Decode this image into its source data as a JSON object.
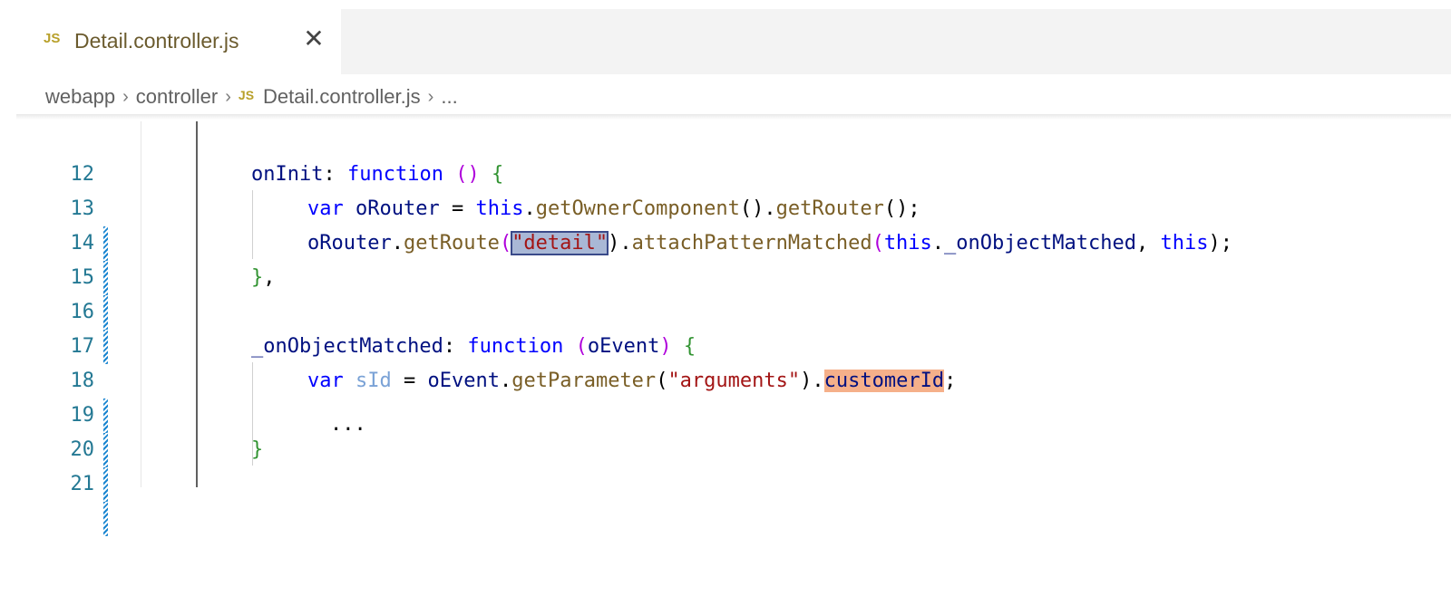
{
  "tab": {
    "icon": "JS",
    "filename": "Detail.controller.js",
    "close_glyph": "✕"
  },
  "breadcrumb": {
    "items": [
      "webapp",
      "controller"
    ],
    "file_icon": "JS",
    "file": "Detail.controller.js",
    "ellipsis": "...",
    "separator": "›"
  },
  "editor": {
    "line_numbers": [
      "12",
      "13",
      "14",
      "15",
      "16",
      "17",
      "18",
      "19",
      "20",
      "21"
    ],
    "lines": {
      "l13": {
        "a": "onInit",
        "b": ": ",
        "c": "function",
        "d": " ",
        "e": "()",
        "f": " ",
        "g": "{"
      },
      "l14": {
        "a": "var",
        "b": " ",
        "c": "oRouter",
        "d": " = ",
        "e": "this",
        "f": ".",
        "g": "getOwnerComponent",
        "h": "().",
        "i": "getRouter",
        "j": "();"
      },
      "l15": {
        "a": "oRouter",
        "b": ".",
        "c": "getRoute",
        "d": "(",
        "e": "\"detail\"",
        "f": ").",
        "g": "attachPatternMatched",
        "h": "(",
        "i": "this",
        "j": ".",
        "k": "_onObjectMatched",
        "l": ", ",
        "m": "this",
        "n": ");"
      },
      "l16": {
        "a": "}",
        "b": ","
      },
      "l18": {
        "a": "_onObjectMatched",
        "b": ": ",
        "c": "function",
        "d": " ",
        "e": "(",
        "f": "oEvent",
        "g": ")",
        "h": " ",
        "i": "{"
      },
      "l19": {
        "a": "var",
        "b": " ",
        "c": "sId",
        "d": " = ",
        "e": "oEvent",
        "f": ".",
        "g": "getParameter",
        "h": "(",
        "i": "\"arguments\"",
        "j": ").",
        "k": "customerId",
        "l": ";"
      },
      "l20": {
        "a": "..."
      },
      "l21": {
        "a": "}"
      }
    }
  },
  "colors": {
    "keyword": "#0000ff",
    "identifier": "#001080",
    "function": "#795e26",
    "string": "#a31515",
    "line_number": "#237893",
    "selection": "#a9b8d6",
    "highlight_orange": "#f5b08a",
    "gutter_modified": "#1a85d0"
  }
}
